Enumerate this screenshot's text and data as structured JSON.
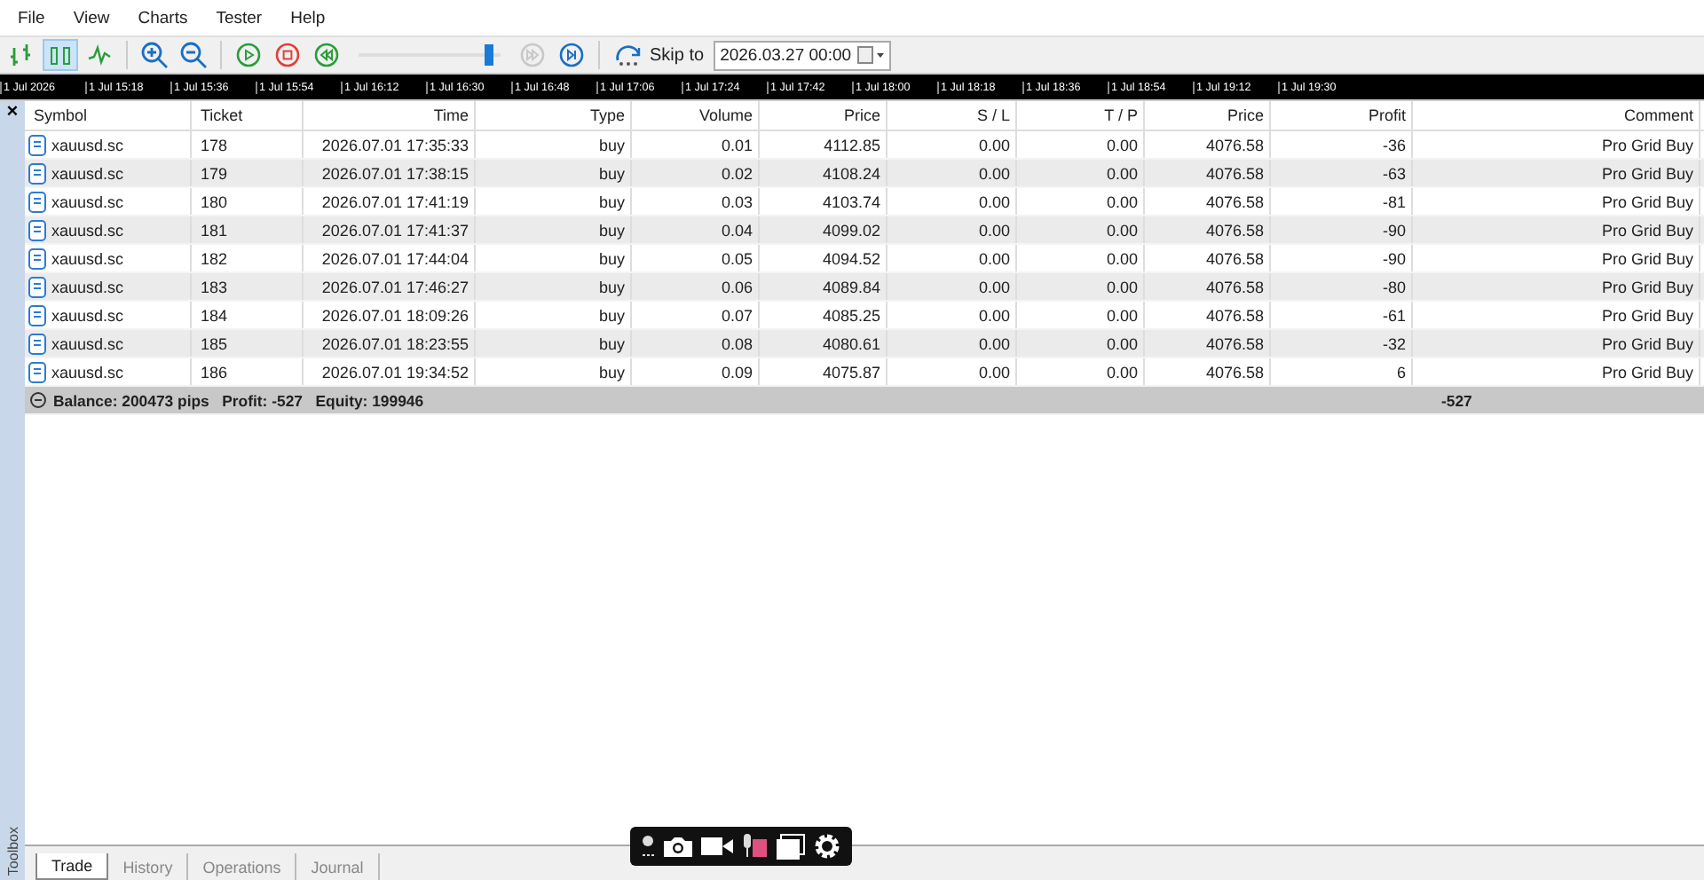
{
  "menu": [
    "File",
    "View",
    "Charts",
    "Tester",
    "Help"
  ],
  "toolbar": {
    "chart_types": [
      {
        "kind": "bar",
        "selected": false
      },
      {
        "kind": "candle",
        "selected": true
      },
      {
        "kind": "line",
        "selected": false
      }
    ],
    "speed": {
      "level": 0.95
    },
    "skip_label": "Skip to",
    "skip_date": "2026.03.27 00:00"
  },
  "time_axis": [
    "1 Jul 2026",
    "1 Jul 15:18",
    "1 Jul 15:36",
    "1 Jul 15:54",
    "1 Jul 16:12",
    "1 Jul 16:30",
    "1 Jul 16:48",
    "1 Jul 17:06",
    "1 Jul 17:24",
    "1 Jul 17:42",
    "1 Jul 18:00",
    "1 Jul 18:18",
    "1 Jul 18:36",
    "1 Jul 18:54",
    "1 Jul 19:12",
    "1 Jul 19:30"
  ],
  "table": {
    "columns": [
      "Symbol",
      "Ticket",
      "Time",
      "Type",
      "Volume",
      "Price",
      "S / L",
      "T / P",
      "Price",
      "Profit",
      "Comment"
    ],
    "rows": [
      [
        "xauusd.sc",
        "178",
        "2026.07.01 17:35:33",
        "buy",
        "0.01",
        "4112.85",
        "0.00",
        "0.00",
        "4076.58",
        "-36",
        "Pro Grid Buy"
      ],
      [
        "xauusd.sc",
        "179",
        "2026.07.01 17:38:15",
        "buy",
        "0.02",
        "4108.24",
        "0.00",
        "0.00",
        "4076.58",
        "-63",
        "Pro Grid Buy"
      ],
      [
        "xauusd.sc",
        "180",
        "2026.07.01 17:41:19",
        "buy",
        "0.03",
        "4103.74",
        "0.00",
        "0.00",
        "4076.58",
        "-81",
        "Pro Grid Buy"
      ],
      [
        "xauusd.sc",
        "181",
        "2026.07.01 17:41:37",
        "buy",
        "0.04",
        "4099.02",
        "0.00",
        "0.00",
        "4076.58",
        "-90",
        "Pro Grid Buy"
      ],
      [
        "xauusd.sc",
        "182",
        "2026.07.01 17:44:04",
        "buy",
        "0.05",
        "4094.52",
        "0.00",
        "0.00",
        "4076.58",
        "-90",
        "Pro Grid Buy"
      ],
      [
        "xauusd.sc",
        "183",
        "2026.07.01 17:46:27",
        "buy",
        "0.06",
        "4089.84",
        "0.00",
        "0.00",
        "4076.58",
        "-80",
        "Pro Grid Buy"
      ],
      [
        "xauusd.sc",
        "184",
        "2026.07.01 18:09:26",
        "buy",
        "0.07",
        "4085.25",
        "0.00",
        "0.00",
        "4076.58",
        "-61",
        "Pro Grid Buy"
      ],
      [
        "xauusd.sc",
        "185",
        "2026.07.01 18:23:55",
        "buy",
        "0.08",
        "4080.61",
        "0.00",
        "0.00",
        "4076.58",
        "-32",
        "Pro Grid Buy"
      ],
      [
        "xauusd.sc",
        "186",
        "2026.07.01 19:34:52",
        "buy",
        "0.09",
        "4075.87",
        "0.00",
        "0.00",
        "4076.58",
        "6",
        "Pro Grid Buy"
      ]
    ],
    "summary": {
      "text": "Balance: 200473 pips   Profit: -527   Equity: 199946",
      "profit": "-527"
    }
  },
  "toolbox_label": "Toolbox",
  "close": "×",
  "tabs": [
    {
      "label": "Trade",
      "selected": true
    },
    {
      "label": "History",
      "selected": false
    },
    {
      "label": "Operations",
      "selected": false
    },
    {
      "label": "Journal",
      "selected": false
    }
  ]
}
